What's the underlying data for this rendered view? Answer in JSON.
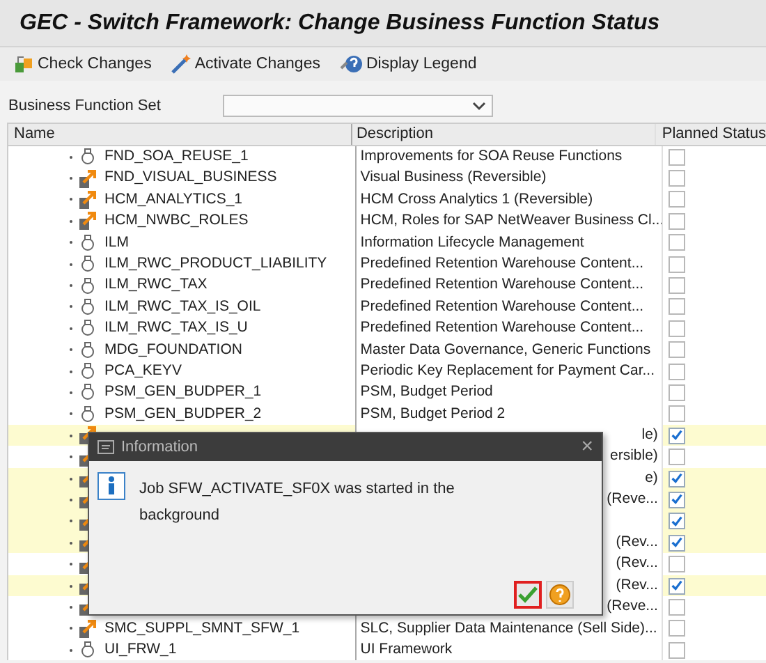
{
  "window": {
    "title": "GEC - Switch Framework: Change Business Function Status"
  },
  "toolbar": [
    {
      "label": "Check Changes",
      "kind": "check"
    },
    {
      "label": "Activate Changes",
      "kind": "activate"
    },
    {
      "label": "Display Legend",
      "kind": "legend"
    }
  ],
  "business_function_set": {
    "label": "Business Function Set"
  },
  "table": {
    "columns": [
      "Name",
      "Description",
      "Planned Status"
    ],
    "rows": [
      {
        "name": "FND_SOA_REUSE_1",
        "kind": "bulb",
        "description": "Improvements for SOA Reuse Functions",
        "checked": false
      },
      {
        "name": "FND_VISUAL_BUSINESS",
        "kind": "switch",
        "description": "Visual Business (Reversible)",
        "checked": false
      },
      {
        "name": "HCM_ANALYTICS_1",
        "kind": "switch",
        "description": "HCM Cross Analytics 1 (Reversible)",
        "checked": false
      },
      {
        "name": "HCM_NWBC_ROLES",
        "kind": "switch",
        "description": "HCM, Roles for SAP NetWeaver Business Cl...",
        "checked": false
      },
      {
        "name": "ILM",
        "kind": "bulb",
        "description": "Information Lifecycle Management",
        "checked": false
      },
      {
        "name": "ILM_RWC_PRODUCT_LIABILITY",
        "kind": "bulb",
        "description": "Predefined Retention Warehouse Content...",
        "checked": false
      },
      {
        "name": "ILM_RWC_TAX",
        "kind": "bulb",
        "description": "Predefined Retention Warehouse Content...",
        "checked": false
      },
      {
        "name": "ILM_RWC_TAX_IS_OIL",
        "kind": "bulb",
        "description": "Predefined Retention Warehouse Content...",
        "checked": false
      },
      {
        "name": "ILM_RWC_TAX_IS_U",
        "kind": "bulb",
        "description": "Predefined Retention Warehouse Content...",
        "checked": false
      },
      {
        "name": "MDG_FOUNDATION",
        "kind": "bulb",
        "description": "Master Data Governance, Generic Functions",
        "checked": false
      },
      {
        "name": "PCA_KEYV",
        "kind": "bulb",
        "description": "Periodic Key Replacement for Payment Car...",
        "checked": false
      },
      {
        "name": "PSM_GEN_BUDPER_1",
        "kind": "bulb",
        "description": "PSM, Budget Period",
        "checked": false
      },
      {
        "name": "PSM_GEN_BUDPER_2",
        "kind": "bulb",
        "description": "PSM, Budget Period 2",
        "checked": false
      },
      {
        "kind": "switch",
        "description": "le)",
        "checked": true
      },
      {
        "kind": "switch",
        "description": "ersible)",
        "checked": false
      },
      {
        "kind": "switch",
        "description": "e)",
        "checked": true
      },
      {
        "kind": "switch",
        "description": "(Reve...",
        "checked": true
      },
      {
        "kind": "switch",
        "checked": true
      },
      {
        "kind": "switch",
        "description": "(Rev...",
        "checked": true
      },
      {
        "kind": "switch",
        "description": "(Rev...",
        "checked": false
      },
      {
        "kind": "switch",
        "description": "(Rev...",
        "checked": true
      },
      {
        "kind": "switch",
        "description": "(Reve...",
        "checked": false
      },
      {
        "name": "SMC_SUPPL_SMNT_SFW_1",
        "kind": "switch",
        "description": "SLC, Supplier Data Maintenance (Sell Side)...",
        "checked": false
      },
      {
        "name": "UI_FRW_1",
        "kind": "bulb",
        "description": "UI Framework",
        "checked": false
      }
    ]
  },
  "dialog": {
    "title": "Information",
    "close": "×",
    "message": "Job SFW_ACTIVATE_SF0X was started in the background"
  }
}
